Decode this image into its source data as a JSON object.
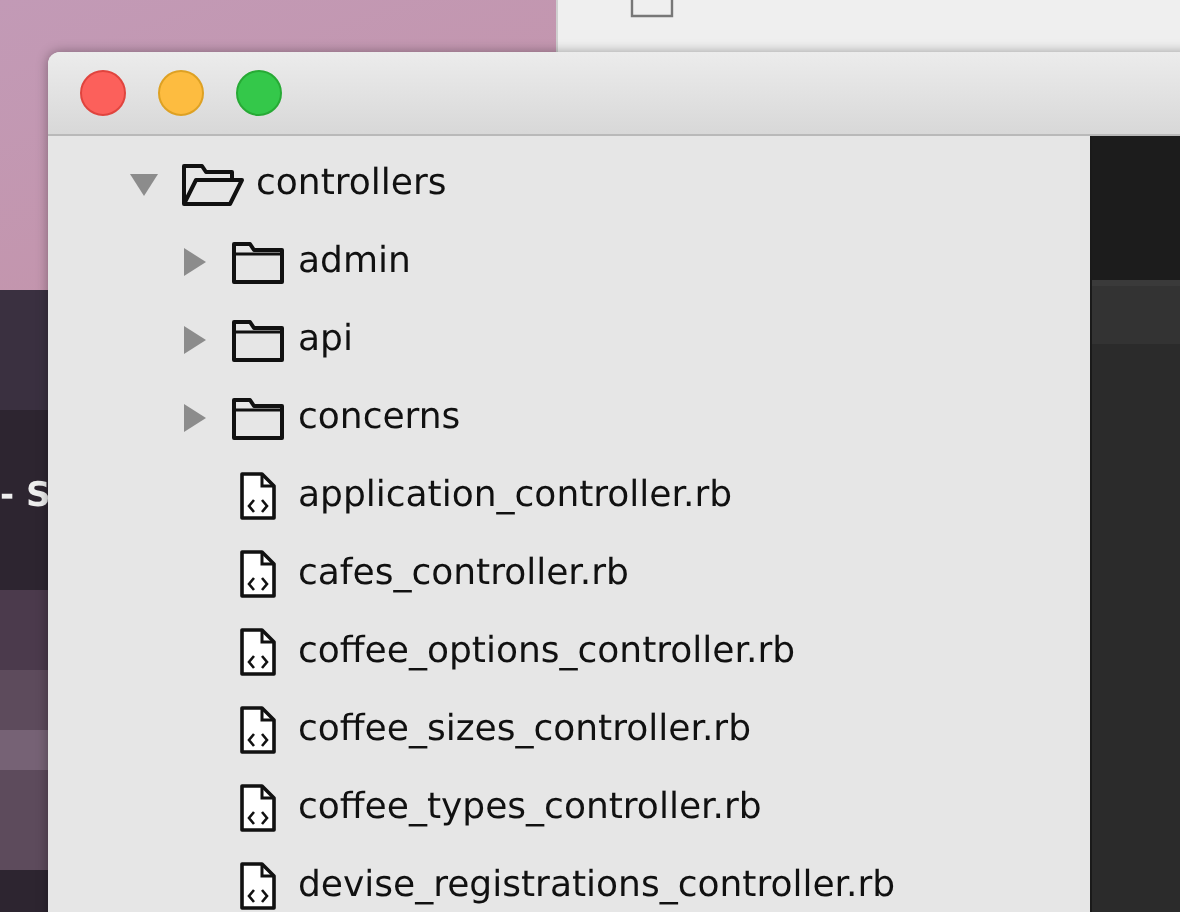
{
  "background_page": {
    "text": "- S"
  },
  "window": {
    "traffic_lights": [
      {
        "kind": "close",
        "color": "#fc605b"
      },
      {
        "kind": "minimize",
        "color": "#fdbc40"
      },
      {
        "kind": "zoom",
        "color": "#34c84a"
      }
    ]
  },
  "tree": [
    {
      "kind": "folder",
      "name": "controllers",
      "expanded": true,
      "children": [
        {
          "kind": "folder",
          "name": "admin",
          "expanded": false
        },
        {
          "kind": "folder",
          "name": "api",
          "expanded": false
        },
        {
          "kind": "folder",
          "name": "concerns",
          "expanded": false
        },
        {
          "kind": "file",
          "name": "application_controller.rb"
        },
        {
          "kind": "file",
          "name": "cafes_controller.rb"
        },
        {
          "kind": "file",
          "name": "coffee_options_controller.rb"
        },
        {
          "kind": "file",
          "name": "coffee_sizes_controller.rb"
        },
        {
          "kind": "file",
          "name": "coffee_types_controller.rb"
        },
        {
          "kind": "file",
          "name": "devise_registrations_controller.rb"
        }
      ]
    }
  ]
}
